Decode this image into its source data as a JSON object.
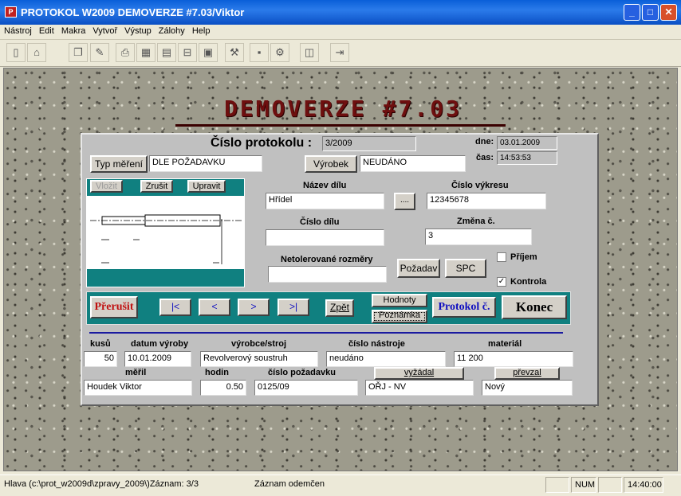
{
  "window": {
    "title": "PROTOKOL W2009  DEMOVERZE  #7.03/Viktor"
  },
  "menu": [
    "Nástroj",
    "Edit",
    "Makra",
    "Vytvoř",
    "Výstup",
    "Zálohy",
    "Help"
  ],
  "banner": "DEMOVERZE  #7.03",
  "header": {
    "cislo_label": "Číslo protokolu :",
    "cislo_value": "3/2009",
    "dne_label": "dne:",
    "dne_value": "03.01.2009",
    "cas_label": "čas:",
    "cas_value": "14:53:53"
  },
  "typ": {
    "button": "Typ měření",
    "value": "DLE POŽADAVKU"
  },
  "vyrobek": {
    "button": "Výrobek",
    "value": "NEUDÁNO"
  },
  "drawing": {
    "vlozit": "Vložit",
    "zrusit": "Zrušit",
    "upravit": "Upravit"
  },
  "fields": {
    "nazev_dilu_label": "Název dílu",
    "nazev_dilu": "Hřídel",
    "ellipsis": "....",
    "cislo_vykresu_label": "Číslo výkresu",
    "cislo_vykresu": "12345678",
    "cislo_dilu_label": "Číslo dílu",
    "cislo_dilu": "",
    "zmena_label": "Změna č.",
    "zmena": "3",
    "netol_label": "Netolerované rozměry",
    "netol": "",
    "pozadav": "Požadav",
    "spc": "SPC",
    "prijem_label": "Příjem",
    "prijem_checked": false,
    "kontrola_label": "Kontrola",
    "kontrola_checked": true
  },
  "nav": {
    "prerusit": "Přerušit",
    "first": "|<",
    "prev": "<",
    "next": ">",
    "last": ">|",
    "zpet": "Zpět",
    "hodnoty": "Hodnoty",
    "poznamka": "Poznámka",
    "protokol": "Protokol č.",
    "konec": "Konec"
  },
  "bottom": {
    "kusu_label": "kusů",
    "kusu": "50",
    "datum_label": "datum výroby",
    "datum": "10.01.2009",
    "vyrobce_label": "výrobce/stroj",
    "vyrobce": "Revolverový soustruh",
    "nastroj_label": "číslo nástroje",
    "nastroj": "neudáno",
    "material_label": "materiál",
    "material": "11 200",
    "meril_label": "měřil",
    "meril": "Houdek Viktor",
    "hodin_label": "hodin",
    "hodin": "0.50",
    "pozadavku_label": "číslo požadavku",
    "pozadavku": "0125/09",
    "vyzadal_button": "vyžádal",
    "vyzadal": "OŘJ - NV",
    "prevzal_button": "převzal",
    "prevzal": "Nový"
  },
  "status": {
    "path": "Hlava (c:\\prot_w2009d\\zpravy_2009\\)Záznam: 3/3",
    "record": "Záznam odemčen",
    "num": "NUM",
    "time": "14:40:00"
  },
  "colors": {
    "titlebar": "#0a5fd8",
    "panel": "#c0c0c0",
    "teal": "#108080",
    "banner": "#6e0f0f",
    "prerusit": "#c01010",
    "protokol": "#1010c0"
  }
}
